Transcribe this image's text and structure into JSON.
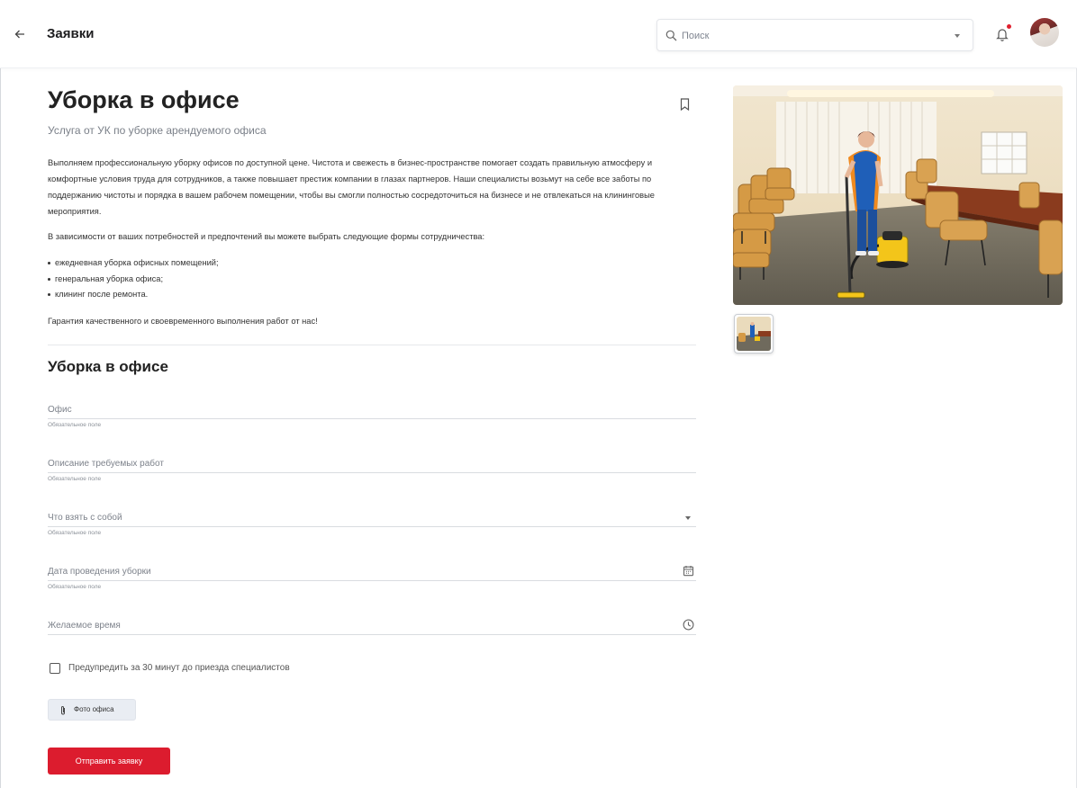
{
  "header": {
    "title": "Заявки",
    "search_placeholder": "Поиск",
    "notification_badge_color": "#e0202e"
  },
  "service": {
    "title": "Уборка в офисе",
    "subtitle": "Услуга от УК по уборке арендуемого офиса",
    "description_1": "Выполняем профессиональную уборку офисов по доступной цене. Чистота и свежесть в бизнес-пространстве помогает создать правильную атмосферу и комфортные условия труда для сотрудников, а также повышает престиж компании в глазах партнеров. Наши специалисты возьмут на себе все заботы по поддержанию чистоты и порядка в вашем рабочем помещении, чтобы вы смогли полностью сосредоточиться на бизнесе и не отвлекаться на клининговые мероприятия.",
    "description_2": "В зависимости от ваших потребностей и предпочтений вы можете выбрать следующие формы сотрудничества:",
    "options": [
      "ежедневная уборка офисных помещений;",
      "генеральная уборка офиса;",
      "клининг после ремонта."
    ],
    "description_3": "Гарантия качественного и своевременного выполнения работ от нас!"
  },
  "form": {
    "title": "Уборка в офисе",
    "required_hint": "Обязательное поле",
    "fields": [
      {
        "label": "Офис",
        "icon": "none"
      },
      {
        "label": "Описание требуемых работ",
        "icon": "none"
      },
      {
        "label": "Что взять с собой",
        "icon": "chevron-down-icon"
      },
      {
        "label": "Дата проведения уборки",
        "icon": "calendar-icon"
      },
      {
        "label": "Желаемое время",
        "icon": "clock-icon"
      }
    ],
    "checkbox_label": "Предупредить за 30 минут до приезда специалистов",
    "checkbox_checked": false,
    "attach_label": "Фото офиса",
    "submit_label": "Отправить заявку"
  },
  "colors": {
    "accent": "#dc1c2e",
    "attach_bg": "#e9edf3"
  }
}
